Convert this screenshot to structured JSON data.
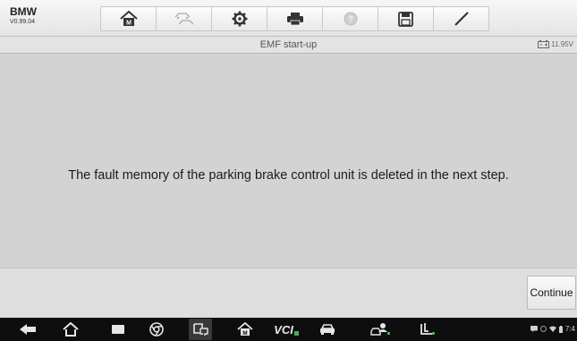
{
  "app": {
    "make": "BMW",
    "version": "V0.99.04"
  },
  "toolbar": {
    "buttons": [
      {
        "name": "home",
        "icon": "home-icon"
      },
      {
        "name": "vehicle-swap",
        "icon": "car-swap-icon"
      },
      {
        "name": "settings",
        "icon": "gear-icon"
      },
      {
        "name": "print",
        "icon": "printer-icon"
      },
      {
        "name": "help",
        "icon": "help-icon"
      },
      {
        "name": "save",
        "icon": "save-icon"
      },
      {
        "name": "data-logging",
        "icon": "pen-icon"
      }
    ]
  },
  "header": {
    "title": "EMF start-up",
    "battery_voltage": "11.95V"
  },
  "main": {
    "message": "The fault memory of the parking brake control unit is deleted in the next step."
  },
  "footer": {
    "continue_label": "Continue"
  },
  "navbar": {
    "vcl_label": "VCI",
    "clock": "7:4"
  },
  "colors": {
    "accent_green": "#4caf50",
    "content_bg": "#d3d3d3",
    "navbar_bg": "#0e0e0e"
  }
}
